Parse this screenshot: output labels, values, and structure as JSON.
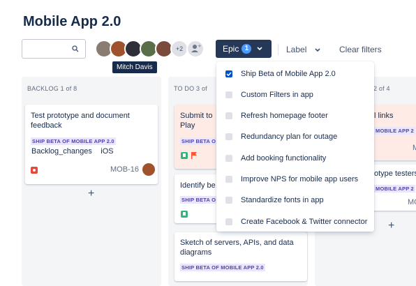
{
  "page": {
    "title": "Mobile App 2.0"
  },
  "toolbar": {
    "avatar_overflow": "+2",
    "tooltip": "Mitch Davis",
    "epic_label": "Epic",
    "epic_count": "1",
    "label_label": "Label",
    "clear_label": "Clear filters"
  },
  "columns": {
    "backlog": {
      "header": "BACKLOG  1 of 8"
    },
    "todo": {
      "header": "TO DO  3 of"
    },
    "third": {
      "header": "2 of 4"
    }
  },
  "cards": {
    "c1": {
      "title": "Test prototype and document feedback",
      "epic": "SHIP BETA OF MOBILE APP 2.0",
      "labels": [
        "Backlog_changes",
        "iOS"
      ],
      "key": "MOB-16"
    },
    "c2": {
      "title": "Submit to \nPlay",
      "epic": "SHIP BETA O"
    },
    "c3": {
      "title": "Identify be",
      "epic": "SHIP BETA O"
    },
    "c4": {
      "title": "Sketch of servers, APIs, and data diagrams",
      "epic": "SHIP BETA OF MOBILE APP 2.0"
    },
    "c5": {
      "title": "l links",
      "epic": "MOBILE APP 2",
      "key": "M"
    },
    "c6": {
      "title": "otype testers",
      "epic": "MOBILE APP 2",
      "key": "MO"
    }
  },
  "plus": "+",
  "menu": {
    "items": [
      {
        "label": "Ship Beta of Mobile App 2.0",
        "checked": true
      },
      {
        "label": "Custom Filters in app",
        "checked": false
      },
      {
        "label": "Refresh homepage footer",
        "checked": false
      },
      {
        "label": "Redundancy plan for outage",
        "checked": false
      },
      {
        "label": "Add booking functionality",
        "checked": false
      },
      {
        "label": "Improve NPS for mobile app users",
        "checked": false
      },
      {
        "label": "Standardize fonts in app",
        "checked": false
      },
      {
        "label": "Create Facebook & Twitter connector",
        "checked": false
      }
    ]
  },
  "colors": {
    "bug": "#e5493a",
    "story": "#36b37e",
    "flag": "#ff5630",
    "accent": "#0052cc"
  },
  "icons": [
    "search-icon",
    "chevron-down-icon",
    "add-person-icon",
    "bug-icon",
    "story-icon",
    "flag-icon",
    "checkmark-icon"
  ]
}
